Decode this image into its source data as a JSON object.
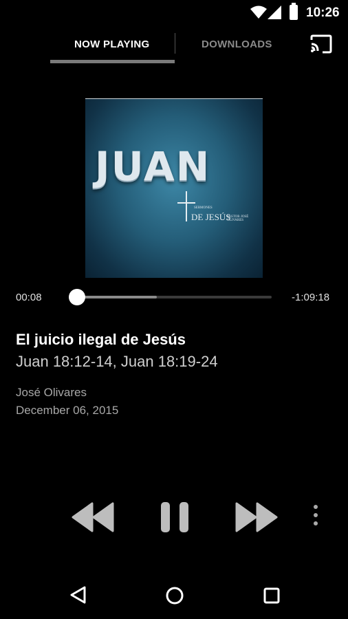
{
  "status_bar": {
    "time": "10:26"
  },
  "tabs": [
    {
      "label": "NOW PLAYING",
      "active": true
    },
    {
      "label": "DOWNLOADS",
      "active": false
    }
  ],
  "album_art": {
    "title": "JUAN",
    "series_small": "SERMONES",
    "series_main": "DE JESÚS",
    "series_sub": "PASTOR JOSÉ OLIVARES"
  },
  "player": {
    "elapsed": "00:08",
    "remaining": "-1:09:18",
    "progress_played_fraction": 0.0,
    "buffered_fraction": 0.41
  },
  "sermon": {
    "title": "El juicio ilegal de Jesús",
    "passage": "Juan 18:12-14, Juan 18:19-24",
    "speaker": "José Olivares",
    "date": "December 06, 2015"
  },
  "icons": {
    "cast": "cast-icon",
    "rewind": "rewind-icon",
    "pause": "pause-icon",
    "fastforward": "fast-forward-icon",
    "more": "more-vert-icon",
    "back": "back-icon",
    "home": "home-icon",
    "recents": "recents-icon"
  },
  "colors": {
    "background": "#000000",
    "album_blue": "#245d78",
    "inactive_tab": "#8a8a8a"
  }
}
